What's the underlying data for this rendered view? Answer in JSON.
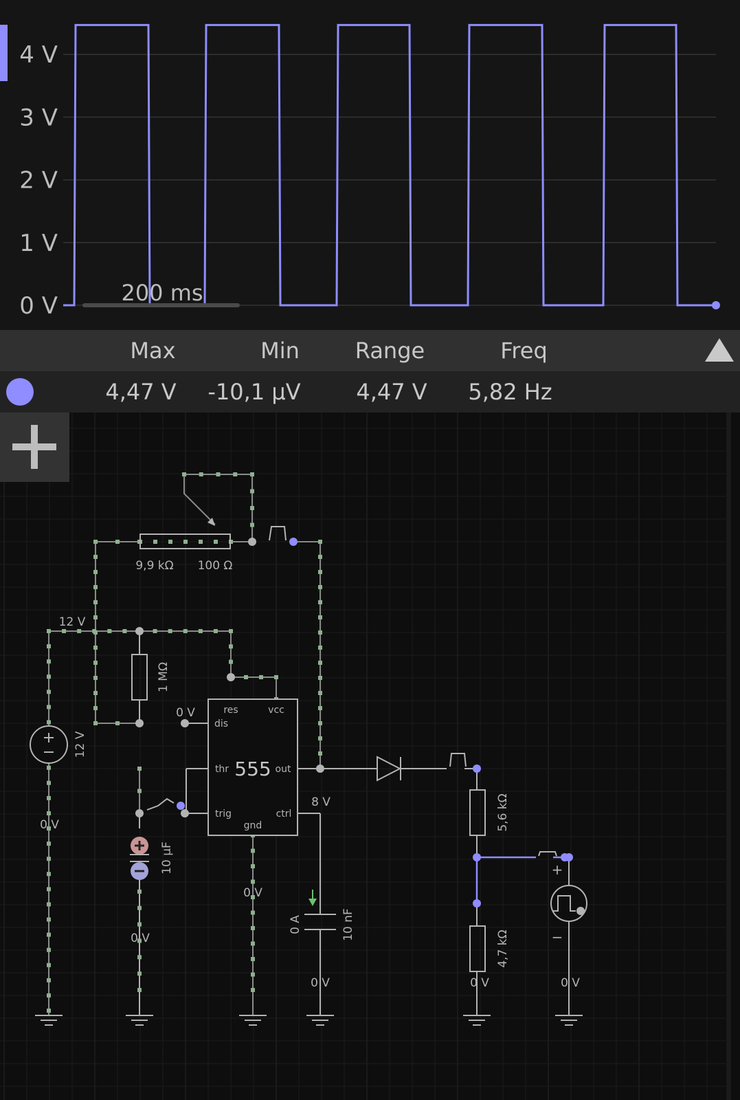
{
  "scope": {
    "y_ticks": [
      "4 V",
      "3 V",
      "2 V",
      "1 V",
      "0 V"
    ],
    "time_scale": "200 ms",
    "trace_color": "#8f8dff"
  },
  "stats": {
    "headers": [
      "Max",
      "Min",
      "Range",
      "Freq"
    ],
    "values": [
      "4,47 V",
      "-10,1 µV",
      "4,47 V",
      "5,82 Hz"
    ]
  },
  "chart_data": {
    "type": "line",
    "xlabel": "",
    "ylabel": "",
    "ylim": [
      0,
      4.5
    ],
    "square_wave_high": 4.47,
    "square_wave_low": 0,
    "series": [
      {
        "values": [
          0,
          4.47,
          0,
          4.47,
          0,
          4.47,
          0,
          4.47,
          0,
          4.47,
          0
        ]
      }
    ]
  },
  "circuit": {
    "labels": {
      "pot_main": "9,9 kΩ",
      "pot_wiper": "100 Ω",
      "supply_node": "12 V",
      "r1": "1 MΩ",
      "dis_node": "0 V",
      "src_value": "12 V",
      "src_bottom": "0 V",
      "cap_value": "10 µF",
      "cap_bottom": "0 V",
      "gnd_node": "0 V",
      "ctrl_node": "8 V",
      "ctrl_cap_current": "0 A",
      "ctrl_cap": "10 nF",
      "ctrl_cap_bottom": "0 V",
      "r_top": "5,6 kΩ",
      "r_bottom": "4,7 kΩ",
      "r_bottom_node": "0 V",
      "out_src_bottom": "0 V",
      "out_src_plus": "+",
      "out_src_minus": "−"
    },
    "chip": {
      "name": "555",
      "pins": {
        "res": "res",
        "vcc": "vcc",
        "dis": "dis",
        "thr": "thr",
        "out": "out",
        "trig": "trig",
        "ctrl": "ctrl",
        "gnd": "gnd"
      }
    }
  }
}
